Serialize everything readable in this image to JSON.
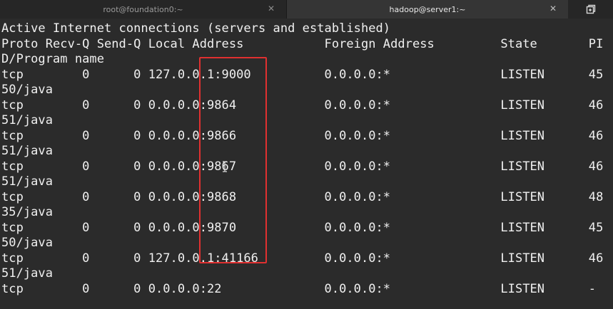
{
  "tabs": [
    {
      "label": "root@foundation0:~",
      "active": false
    },
    {
      "label": "hadoop@server1:~",
      "active": true
    }
  ],
  "icons": {
    "close": "close-icon",
    "new_tab": "new-tab-icon"
  },
  "colors": {
    "terminal_bg": "#2b2b2b",
    "text": "#f0f0f0",
    "highlight": "#e03030"
  },
  "terminal": {
    "lines": [
      "Active Internet connections (servers and established)",
      "Proto Recv-Q Send-Q Local Address           Foreign Address         State       PI",
      "D/Program name",
      "tcp        0      0 127.0.0.1:9000          0.0.0.0:*               LISTEN      45",
      "50/java",
      "tcp        0      0 0.0.0.0:9864            0.0.0.0:*               LISTEN      46",
      "51/java",
      "tcp        0      0 0.0.0.0:9866            0.0.0.0:*               LISTEN      46",
      "51/java",
      "tcp        0      0 0.0.0.0:9867            0.0.0.0:*               LISTEN      46",
      "51/java",
      "tcp        0      0 0.0.0.0:9868            0.0.0.0:*               LISTEN      48",
      "35/java",
      "tcp        0      0 0.0.0.0:9870            0.0.0.0:*               LISTEN      45",
      "50/java",
      "tcp        0      0 127.0.0.1:41166         0.0.0.0:*               LISTEN      46",
      "51/java",
      "tcp        0      0 0.0.0.0:22              0.0.0.0:*               LISTEN      -"
    ]
  }
}
